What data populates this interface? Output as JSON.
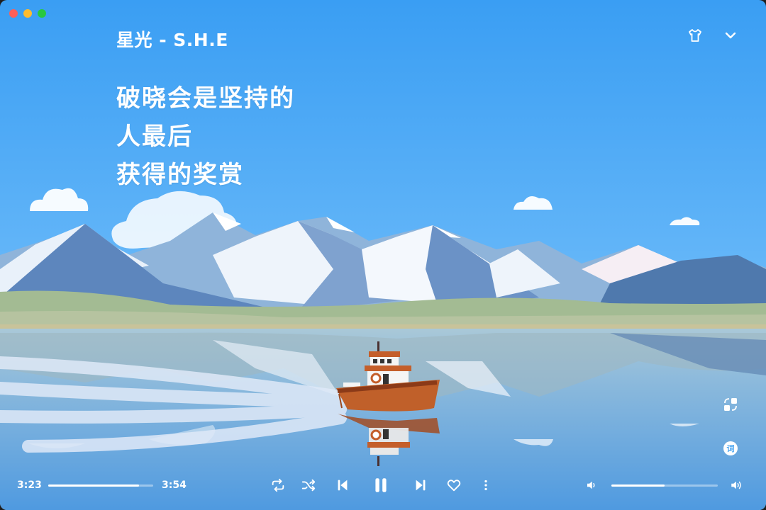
{
  "song": {
    "title": "星光 - S.H.E"
  },
  "lyrics": [
    "破晓会是坚持的",
    "人最后",
    "获得的奖赏"
  ],
  "player": {
    "current_time": "3:23",
    "total_time": "3:54",
    "progress_fraction": 0.866,
    "volume_fraction": 0.5
  },
  "icons": {
    "top": [
      "tshirt-icon",
      "chevron-down-icon"
    ],
    "side": [
      "swap-layout-icon",
      "lyrics-icon"
    ],
    "controls": [
      "repeat-icon",
      "shuffle-icon",
      "previous-icon",
      "pause-icon",
      "next-icon",
      "heart-icon",
      "more-icon",
      "volume-low-icon",
      "volume-high-icon"
    ]
  },
  "colors": {
    "sky_top": "#3ea1f3",
    "sky_bottom": "#8ccafa",
    "water": "#7fb3da",
    "boat": "#c0602a",
    "close": "#ff5f57",
    "minimize": "#febc2e",
    "zoom": "#28c840"
  }
}
